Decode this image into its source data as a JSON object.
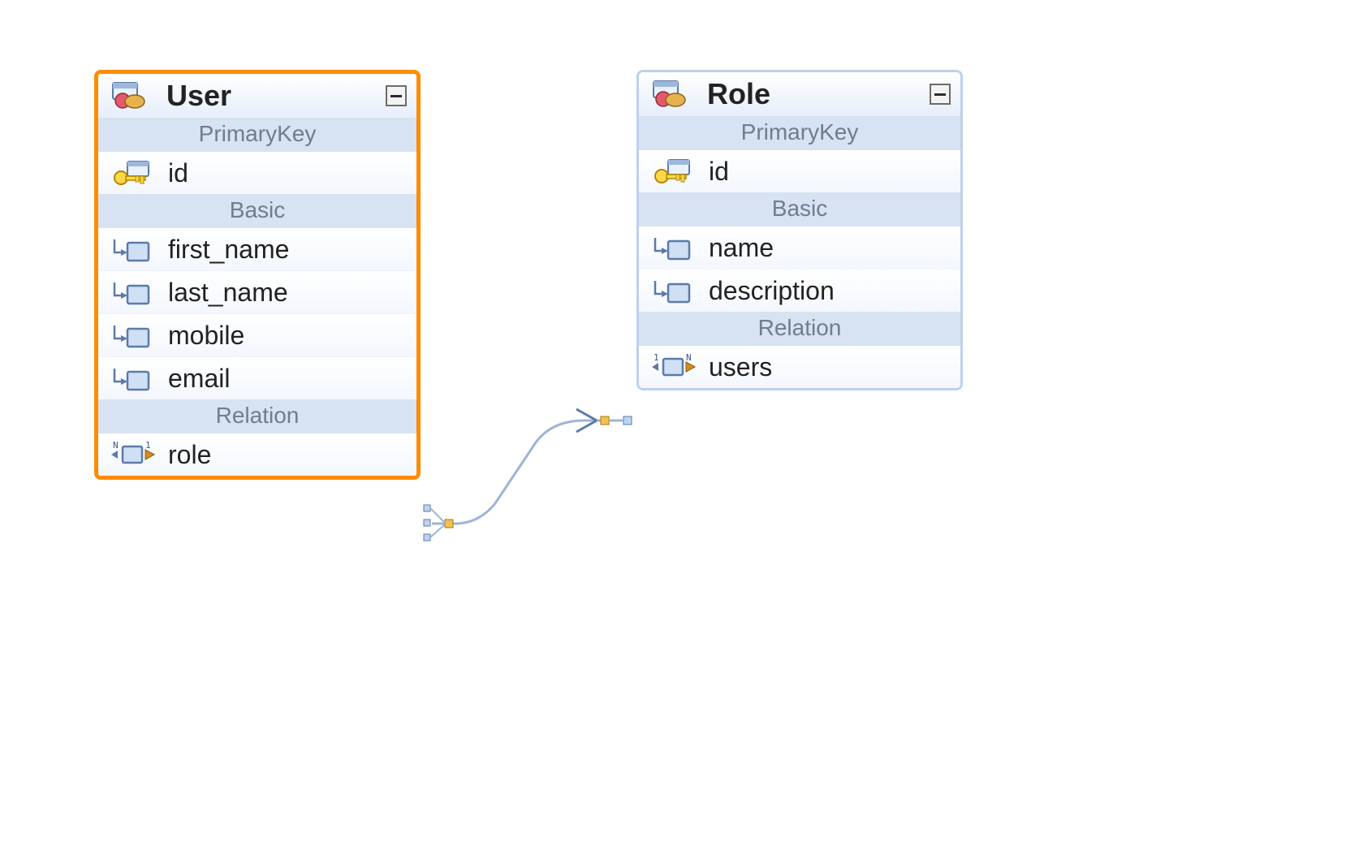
{
  "entities": {
    "user": {
      "title": "User",
      "selected": true,
      "sections": {
        "primaryKey": {
          "label": "PrimaryKey",
          "fields": [
            {
              "name": "id",
              "icon": "key"
            }
          ]
        },
        "basic": {
          "label": "Basic",
          "fields": [
            {
              "name": "first_name",
              "icon": "attr"
            },
            {
              "name": "last_name",
              "icon": "attr"
            },
            {
              "name": "mobile",
              "icon": "attr"
            },
            {
              "name": "email",
              "icon": "attr"
            }
          ]
        },
        "relation": {
          "label": "Relation",
          "fields": [
            {
              "name": "role",
              "icon": "rel-out"
            }
          ]
        }
      }
    },
    "role": {
      "title": "Role",
      "selected": false,
      "sections": {
        "primaryKey": {
          "label": "PrimaryKey",
          "fields": [
            {
              "name": "id",
              "icon": "key"
            }
          ]
        },
        "basic": {
          "label": "Basic",
          "fields": [
            {
              "name": "name",
              "icon": "attr"
            },
            {
              "name": "description",
              "icon": "attr"
            }
          ]
        },
        "relation": {
          "label": "Relation",
          "fields": [
            {
              "name": "users",
              "icon": "rel-in"
            }
          ]
        }
      }
    }
  },
  "relationship": {
    "from": "user.role",
    "to": "role.users",
    "type": "many-to-many"
  }
}
